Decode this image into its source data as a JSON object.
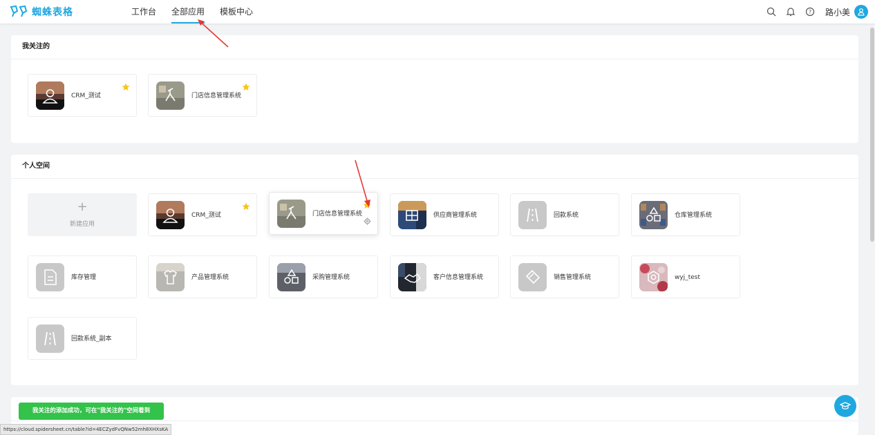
{
  "app": {
    "name": "蜘蛛表格"
  },
  "nav": {
    "items": [
      "工作台",
      "全部应用",
      "模板中心"
    ],
    "active_index": 1
  },
  "user": {
    "name": "路小美"
  },
  "sections": {
    "favorites": {
      "title": "我关注的",
      "apps": [
        {
          "name": "CRM_测试",
          "starred": true
        },
        {
          "name": "门店信息管理系统",
          "starred": true
        }
      ]
    },
    "personal": {
      "title": "个人空间",
      "new_app_label": "新建应用",
      "new_app_plus": "+",
      "apps": [
        {
          "name": "CRM_测试",
          "starred": true
        },
        {
          "name": "门店信息管理系统",
          "starred": true,
          "hovered": true
        },
        {
          "name": "供应商管理系统"
        },
        {
          "name": "回款系统"
        },
        {
          "name": "仓库管理系统"
        },
        {
          "name": "库存管理"
        },
        {
          "name": "产品管理系统"
        },
        {
          "name": "采购管理系统"
        },
        {
          "name": "客户信息管理系统"
        },
        {
          "name": "销售管理系统"
        },
        {
          "name": "wyj_test"
        },
        {
          "name": "回款系统_副本"
        }
      ]
    }
  },
  "toast": {
    "message": "我关注的添加成功，可在\"我关注的\"空间看到"
  },
  "status_url": "https://cloud.spidersheet.cn/table?id=4ECZydFvQNw52mh8XHXsKA",
  "colors": {
    "accent": "#1fa8e0",
    "toast": "#33c24a",
    "star": "#f5c518",
    "annotation": "#e53935"
  }
}
